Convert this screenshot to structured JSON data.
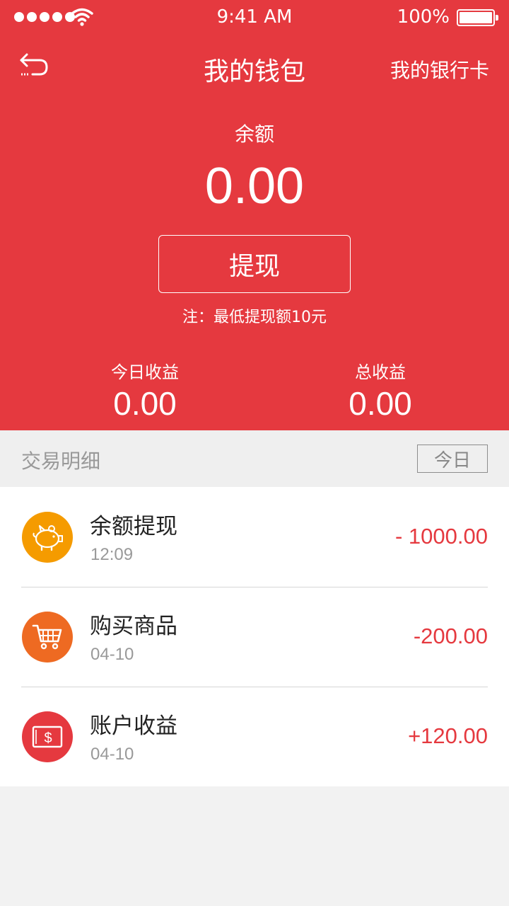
{
  "status_bar": {
    "time": "9:41 AM",
    "battery": "100%"
  },
  "nav": {
    "title": "我的钱包",
    "right_link": "我的银行卡"
  },
  "wallet": {
    "balance_label": "余额",
    "balance": "0.00",
    "withdraw_label": "提现",
    "note": "注：最低提现额10元"
  },
  "stats": {
    "today": {
      "label": "今日收益",
      "value": "0.00"
    },
    "total": {
      "label": "总收益",
      "value": "0.00"
    }
  },
  "transactions": {
    "title": "交易明细",
    "filter": "今日",
    "items": [
      {
        "title": "余额提现",
        "sub": "12:09",
        "amount": "- 1000.00",
        "icon": "piggy-bank-icon",
        "color": "#f59b00"
      },
      {
        "title": "购买商品",
        "sub": "04-10",
        "amount": "-200.00",
        "icon": "shopping-cart-icon",
        "color": "#ee6a22"
      },
      {
        "title": "账户收益",
        "sub": "04-10",
        "amount": "+120.00",
        "icon": "dollar-card-icon",
        "color": "#e5393f"
      }
    ]
  },
  "colors": {
    "primary": "#e5393f",
    "text": "#222222",
    "muted": "#999999"
  }
}
